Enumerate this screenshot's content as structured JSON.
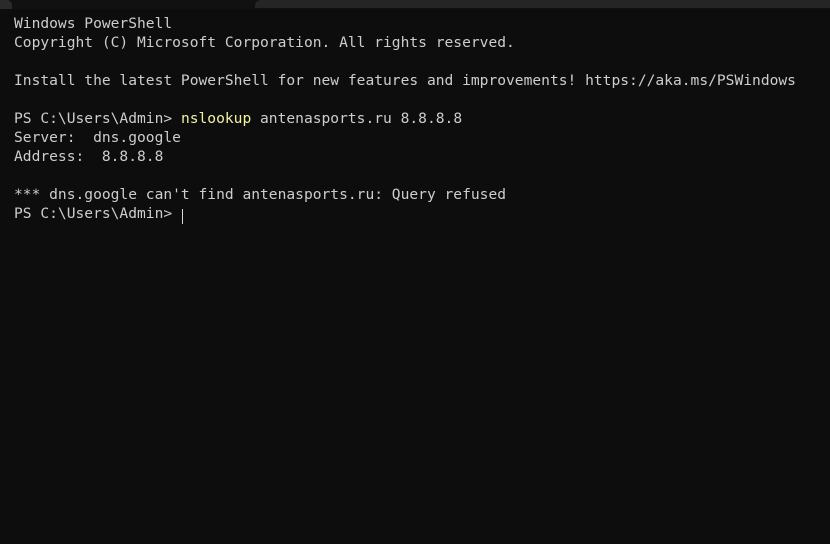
{
  "window": {
    "title": "Windows PowerShell",
    "background_color": "#0d0d0d",
    "foreground_color": "#cdcdcd",
    "accent_color": "#f2f2a0",
    "titlebar_color": "#252526"
  },
  "console": {
    "lines": [
      {
        "id": "banner-title",
        "text": "Windows PowerShell"
      },
      {
        "id": "banner-copyright",
        "text": "Copyright (C) Microsoft Corporation. All rights reserved."
      },
      {
        "id": "blank-1",
        "text": ""
      },
      {
        "id": "banner-upgrade",
        "text": "Install the latest PowerShell for new features and improvements! https://aka.ms/PSWindows"
      },
      {
        "id": "blank-2",
        "text": ""
      }
    ],
    "command_line": {
      "prompt": "PS C:\\Users\\Admin> ",
      "command": "nslookup",
      "arguments": " antenasports.ru 8.8.8.8"
    },
    "output": [
      {
        "id": "server-line",
        "text": "Server:  dns.google"
      },
      {
        "id": "address-line",
        "text": "Address:  8.8.8.8"
      },
      {
        "id": "blank-3",
        "text": ""
      },
      {
        "id": "error-line",
        "text": "*** dns.google can't find antenasports.ru: Query refused"
      }
    ],
    "final_prompt": {
      "prompt": "PS C:\\Users\\Admin> "
    }
  }
}
